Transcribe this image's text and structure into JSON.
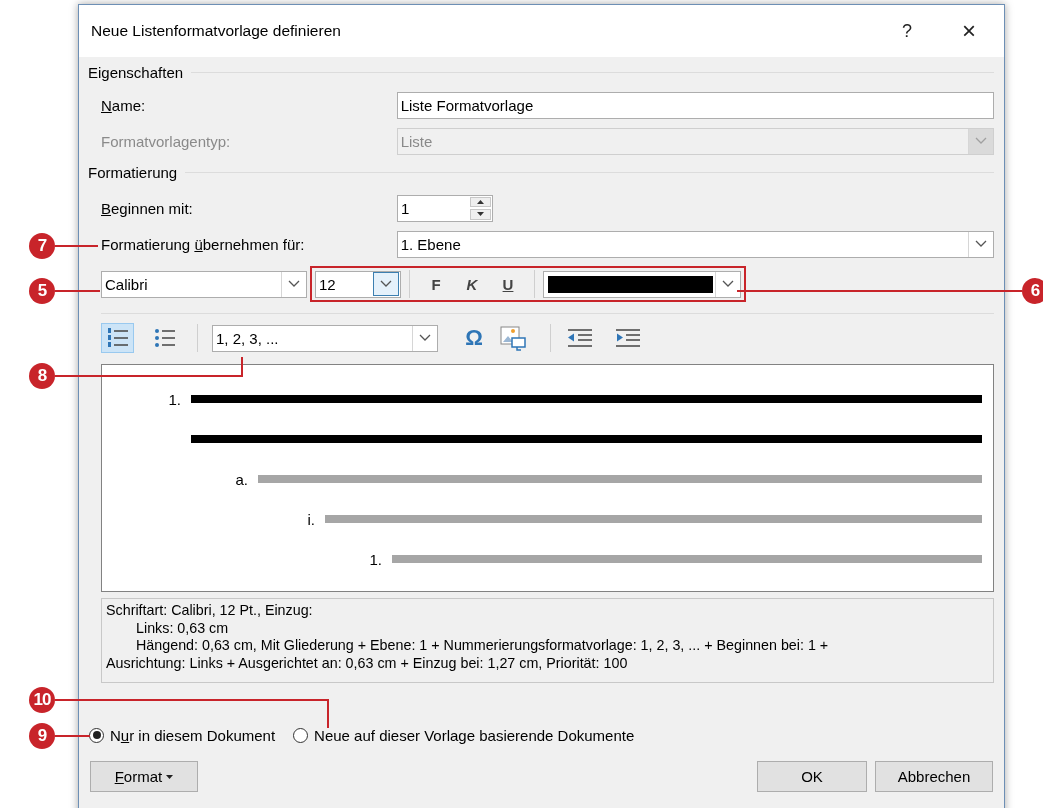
{
  "window": {
    "title": "Neue Listenformatvorlage definieren",
    "help": "?",
    "close": "×"
  },
  "properties": {
    "heading": "Eigenschaften",
    "name": {
      "label": {
        "key": "N",
        "after": "ame:"
      },
      "value": "Liste Formatvorlage"
    },
    "type": {
      "label": "Formatvorlagentyp:",
      "value": "Liste",
      "disabled": true
    }
  },
  "formatting": {
    "heading": "Formatierung",
    "start": {
      "label": {
        "key": "B",
        "after": "eginnen mit:"
      },
      "value": "1"
    },
    "apply_to": {
      "label": {
        "before": "Formatierung ",
        "key": "ü",
        "after": "bernehmen für:"
      },
      "value": "1. Ebene"
    },
    "font": "Calibri",
    "size": "12",
    "styles": [
      {
        "label": "F",
        "kind": "bold"
      },
      {
        "label": "K",
        "kind": "italic"
      },
      {
        "label": "U",
        "kind": "underline"
      }
    ],
    "font_color": {
      "color": "#000000"
    }
  },
  "toolbar": {
    "numbering_selected": true,
    "bullets_selected": false,
    "number_format": "1, 2, 3, ...",
    "symbol": "Ω"
  },
  "preview": [
    {
      "marker": "1.",
      "color": "#000000",
      "continued": true,
      "children": [
        {
          "marker": "a.",
          "color": "#a6a6a6",
          "continued": false,
          "children": [
            {
              "marker": "i.",
              "color": "#a6a6a6",
              "continued": false,
              "children": [
                {
                  "marker": "1.",
                  "color": "#a6a6a6",
                  "continued": false
                }
              ]
            }
          ]
        }
      ]
    }
  ],
  "description": [
    {
      "text": "Schriftart: Calibri, 12 Pt., Einzug:",
      "indent": false
    },
    {
      "text": "Links:  0,63 cm",
      "indent": true
    },
    {
      "text": "Hängend:  0,63 cm, Mit Gliederung + Ebene: 1 + Nummerierungsformatvorlage: 1, 2, 3, ... + Beginnen bei: 1 +",
      "indent": true
    },
    {
      "text": "Ausrichtung: Links + Ausgerichtet an:  0,63 cm + Einzug bei:  1,27 cm, Priorität: 100",
      "indent": false
    }
  ],
  "scope": [
    {
      "label": {
        "before": "N",
        "key": "u",
        "after": "r in diesem Dokument"
      },
      "selected": true
    },
    {
      "label": {
        "before": "Neue auf dieser Vorlage basierende Dokumente"
      },
      "selected": false
    }
  ],
  "buttons": {
    "format": {
      "label": {
        "key": "F",
        "after": "ormat"
      }
    },
    "ok": "OK",
    "cancel": "Abbrechen"
  },
  "callouts": [
    {
      "number": "7"
    },
    {
      "number": "5"
    },
    {
      "number": "6"
    },
    {
      "number": "8"
    },
    {
      "number": "10"
    },
    {
      "number": "9"
    }
  ]
}
